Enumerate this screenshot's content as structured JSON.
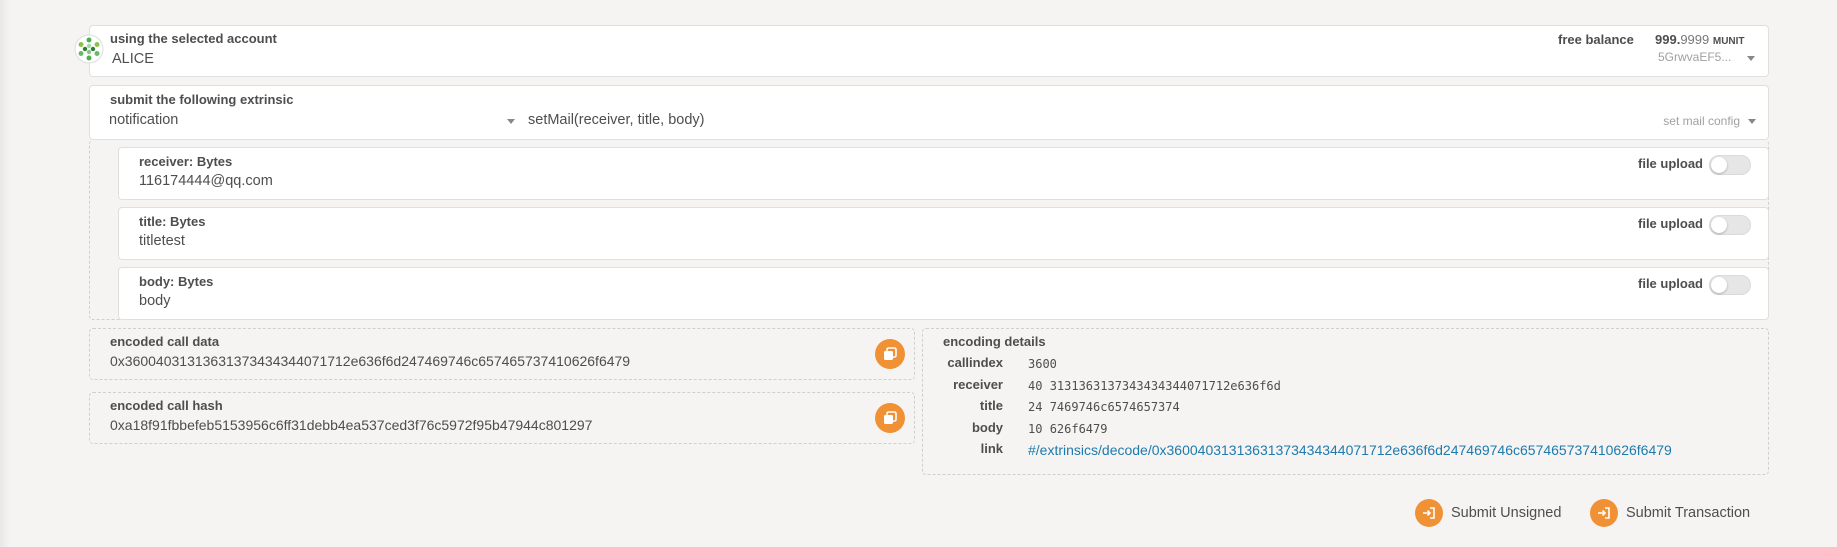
{
  "account": {
    "label": "using the selected account",
    "name": "ALICE",
    "free_balance_label": "free balance",
    "balance_int": "999.",
    "balance_dec": "9999",
    "balance_unit": "MUNIT",
    "address_short": "5GrwvaEF5..."
  },
  "extrinsic": {
    "label": "submit the following extrinsic",
    "module": "notification",
    "method": "setMail(receiver, title, body)",
    "method_doc": "set mail config"
  },
  "params": [
    {
      "label": "receiver: Bytes",
      "value": "116174444@qq.com",
      "file_upload": "file upload"
    },
    {
      "label": "title: Bytes",
      "value": "titletest",
      "file_upload": "file upload"
    },
    {
      "label": "body: Bytes",
      "value": "body",
      "file_upload": "file upload"
    }
  ],
  "encoded_call_data": {
    "label": "encoded call data",
    "value": "0x36004031313631373434344071712e636f6d247469746c657465737410626f6479"
  },
  "encoded_call_hash": {
    "label": "encoded call hash",
    "value": "0xa18f91fbbefeb5153956c6ff31debb4ea537ced3f76c5972f95b47944c801297"
  },
  "encoding_details": {
    "label": "encoding details",
    "callindex_label": "callindex",
    "callindex": "3600",
    "receiver_label": "receiver",
    "receiver_len": "40",
    "receiver_hex": "313136313734343434407171 2e636f6d",
    "receiver_hex_display": "3131363137343434344071712e636f6d",
    "title_label": "title",
    "title_len": "24",
    "title_hex": "7469746c6574657374",
    "body_label": "body",
    "body_len": "10",
    "body_hex": "626f6479",
    "link_label": "link",
    "link": "#/extrinsics/decode/0x36004031313631373434344071712e636f6d247469746c657465737410626f6479"
  },
  "actions": {
    "submit_unsigned": "Submit Unsigned",
    "submit_transaction": "Submit Transaction"
  },
  "colors": {
    "accent": "#f19135",
    "link": "#1f7aad",
    "identicon": "#4caf50"
  }
}
